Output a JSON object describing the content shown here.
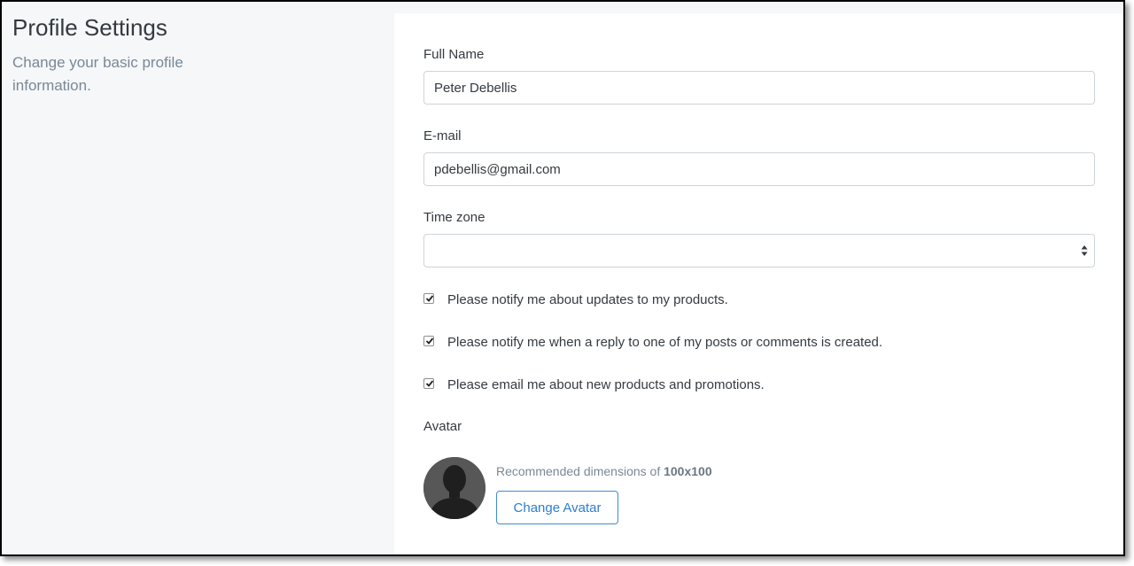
{
  "header": {
    "title": "Profile Settings",
    "subtitle": "Change your basic profile information."
  },
  "form": {
    "full_name": {
      "label": "Full Name",
      "value": "Peter Debellis"
    },
    "email": {
      "label": "E-mail",
      "value": "pdebellis@gmail.com"
    },
    "timezone": {
      "label": "Time zone",
      "value": ""
    },
    "checkboxes": [
      {
        "label": "Please notify me about updates to my products.",
        "checked": true
      },
      {
        "label": "Please notify me when a reply to one of my posts or comments is created.",
        "checked": true
      },
      {
        "label": "Please email me about new products and promotions.",
        "checked": true
      }
    ],
    "avatar": {
      "label": "Avatar",
      "hint_prefix": "Recommended dimensions of",
      "hint_size": "100x100",
      "button_label": "Change Avatar"
    }
  },
  "colors": {
    "accent": "#2c7fd0",
    "page_bg": "#f5f7f9",
    "muted_text": "#7a8896"
  },
  "icons": {
    "checkbox": "check-icon",
    "select": "sort-arrows-icon",
    "avatar": "user-silhouette-icon"
  }
}
